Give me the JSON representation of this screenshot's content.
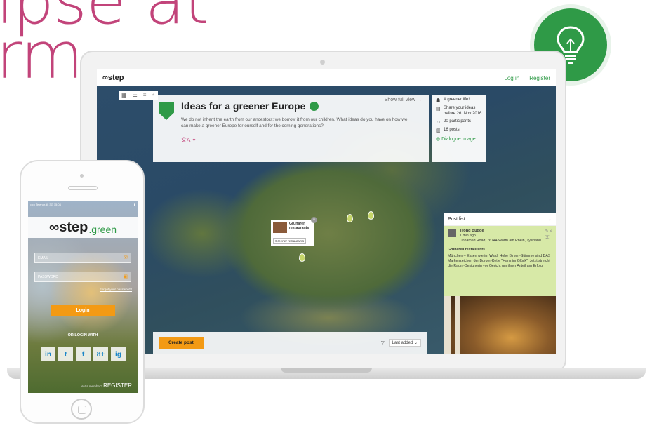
{
  "headline": {
    "line1": "lpse at",
    "line2": "rm"
  },
  "colors": {
    "brand_green": "#2f9a47",
    "accent_orange": "#f39a14",
    "accent_pink": "#c2447a"
  },
  "laptop": {
    "appbar": {
      "logo": "step",
      "login": "Log in",
      "register": "Register"
    },
    "idea": {
      "show_full_view": "Show full view",
      "title": "Ideas for a greener Europe",
      "description": "We do not inherit the earth from our ancestors; we borrow it from our children. What ideas do you have on how we can make a greener Europe for ourself and for the coming generations?",
      "translate_icon": "translate-icon"
    },
    "stats": {
      "line1": "A greener life!",
      "line2": "Share your ideas before 26. Nov 2016",
      "participants": "20 participants",
      "posts": "16 posts",
      "dialogue": "Dialogue image"
    },
    "popup": {
      "title": "Grünaren restaurants",
      "tag": "Greener restaurants"
    },
    "post_list": {
      "title": "Post list",
      "author": "Trond Bugge",
      "time": "1 min ago",
      "address": "Unnamed Road, 76744 Wörth am Rhein, Tyskland",
      "post_title": "Grünaren restaurants",
      "post_body": "München – Essen wie im Wald: Hohe Birken-Stämme sind DAS Markenzeichen der Burger-Kette \"Hans im Glück\". Jetzt streicht die Raum-Designerin vor Gericht um ihren Anteil am Erfolg.",
      "likes": "0",
      "comments": "0"
    },
    "footer": {
      "create_post": "Create post",
      "sort_label": "Last added"
    }
  },
  "phone": {
    "status_left": "••••• Telenor.dk  3G  15:04",
    "logo_main": "step",
    "logo_sub": ".green",
    "email_placeholder": "EMAIL",
    "password_placeholder": "PASSWORD",
    "forgot": "Forgot your password?",
    "login": "Login",
    "or_login_with": "OR LOGIN WITH",
    "social": [
      "in",
      "t",
      "f",
      "8+",
      "ig"
    ],
    "not_member": "Not a member?",
    "register": "REGISTER"
  }
}
